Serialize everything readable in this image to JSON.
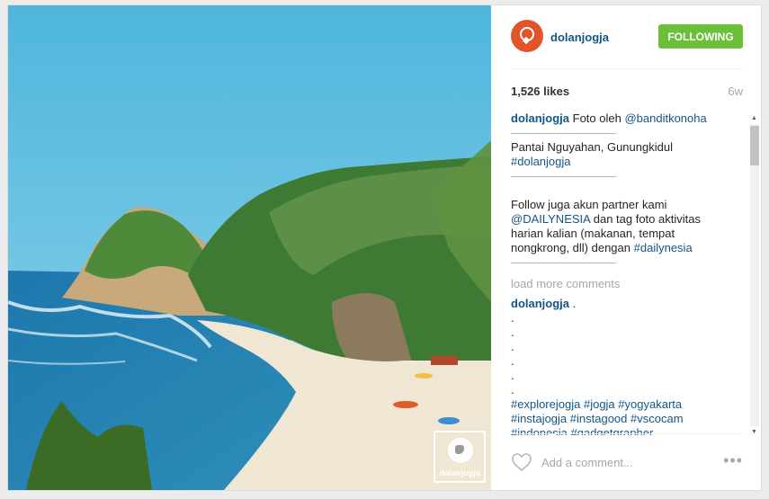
{
  "post": {
    "username": "dolanjogja",
    "follow_label": "FOLLOWING",
    "likes": "1,526 likes",
    "age": "6w",
    "watermark_text": "dolanjogja",
    "colors": {
      "follow": "#6bbf3a",
      "link": "#125688",
      "avatar": "#e2552a"
    }
  },
  "caption": {
    "username": "dolanjogja",
    "intro": "Foto oleh",
    "credit": "@banditkonoha",
    "divider": "—————————",
    "location": "Pantai Nguyahan, Gunungkidul",
    "tag1": "#dolanjogja",
    "follow_text": "Follow juga akun partner kami",
    "partner": "@DAILYNESIA",
    "follow_text2": "dan tag foto aktivitas harian kalian (makanan, tempat nongkrong, dll) dengan",
    "partner_tag": "#dailynesia"
  },
  "load_more": "load more comments",
  "comment": {
    "username": "dolanjogja",
    "text": ".",
    "dot": ".",
    "tags": [
      "#explorejogja",
      "#jogja",
      "#yogyakarta",
      "#instajogja",
      "#instagood",
      "#vscocam",
      "#indonesia",
      "#gadgetgrapher"
    ]
  },
  "footer": {
    "placeholder": "Add a comment...",
    "more": "•••",
    "icons": {
      "like": "heart-icon",
      "options": "more-options-icon"
    }
  }
}
